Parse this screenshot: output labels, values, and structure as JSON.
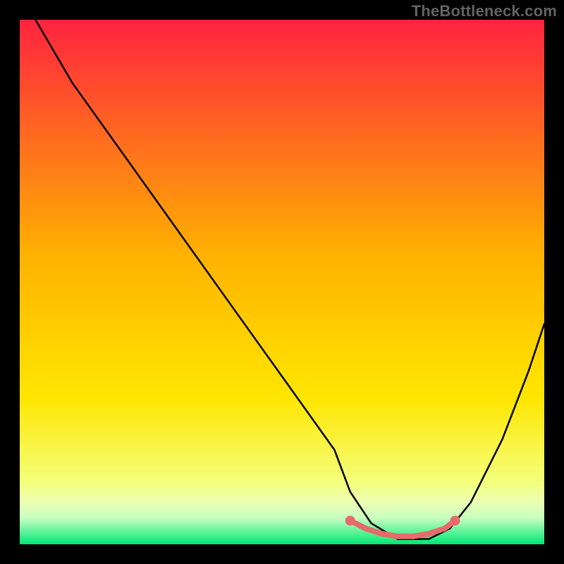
{
  "watermark": "TheBottleneck.com",
  "chart_data": {
    "type": "line",
    "title": "",
    "xlabel": "",
    "ylabel": "",
    "xlim": [
      0,
      100
    ],
    "ylim": [
      0,
      100
    ],
    "background_gradient": {
      "top": "#ff233f",
      "mid": "#ffdd00",
      "bottom": "#00e874"
    },
    "series": [
      {
        "name": "bottleneck-curve",
        "x": [
          3,
          10,
          20,
          30,
          40,
          50,
          60,
          63,
          67,
          72,
          75,
          78,
          82,
          86,
          92,
          97,
          100
        ],
        "values": [
          100,
          88,
          74,
          60,
          46,
          32,
          18,
          10,
          4,
          1,
          1,
          1,
          3,
          8,
          20,
          33,
          42
        ]
      }
    ],
    "flat_zone": {
      "x_start": 63,
      "x_end": 83,
      "points_x": [
        63,
        66,
        69,
        72,
        75,
        78,
        81,
        83
      ],
      "points_y": [
        4.5,
        3,
        2,
        1.5,
        1.5,
        2,
        3,
        4.5
      ],
      "color": "#e86b6b",
      "endpoint_radius": 7,
      "dot_radius": 4
    }
  }
}
